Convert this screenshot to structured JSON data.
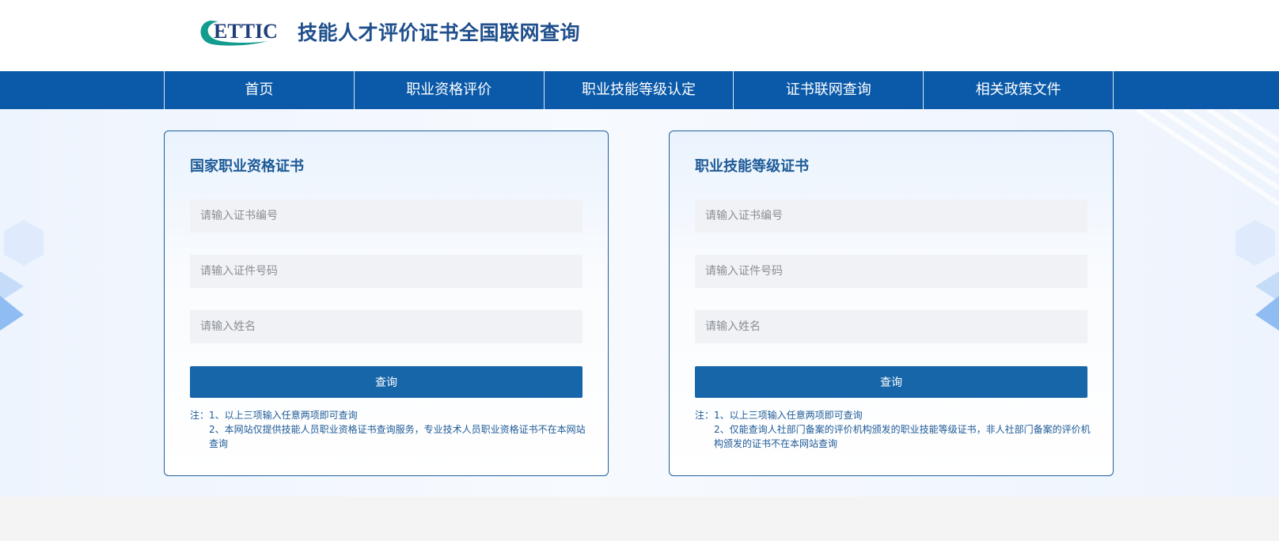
{
  "header": {
    "logo_text": "ETTIC",
    "site_title": "技能人才评价证书全国联网查询"
  },
  "nav": {
    "items": [
      {
        "label": "首页"
      },
      {
        "label": "职业资格评价"
      },
      {
        "label": "职业技能等级认定"
      },
      {
        "label": "证书联网查询"
      },
      {
        "label": "相关政策文件"
      }
    ]
  },
  "cards": {
    "left": {
      "title": "国家职业资格证书",
      "cert_no_placeholder": "请输入证书编号",
      "id_no_placeholder": "请输入证件号码",
      "name_placeholder": "请输入姓名",
      "query_label": "查询",
      "note_1": "注：1、以上三项输入任意两项即可查询",
      "note_2": "2、本网站仅提供技能人员职业资格证书查询服务，专业技术人员职业资格证书不在本网站查询"
    },
    "right": {
      "title": "职业技能等级证书",
      "cert_no_placeholder": "请输入证书编号",
      "id_no_placeholder": "请输入证件号码",
      "name_placeholder": "请输入姓名",
      "query_label": "查询",
      "note_1": "注：1、以上三项输入任意两项即可查询",
      "note_2": "2、仅能查询人社部门备案的评价机构颁发的职业技能等级证书，非人社部门备案的评价机构颁发的证书不在本网站查询"
    }
  },
  "colors": {
    "nav_bg": "#0b5aa9",
    "title_color": "#1f4f8c",
    "button_bg": "#1766a9",
    "card_border": "#1f5f9c",
    "logo_teal": "#119c8e"
  }
}
